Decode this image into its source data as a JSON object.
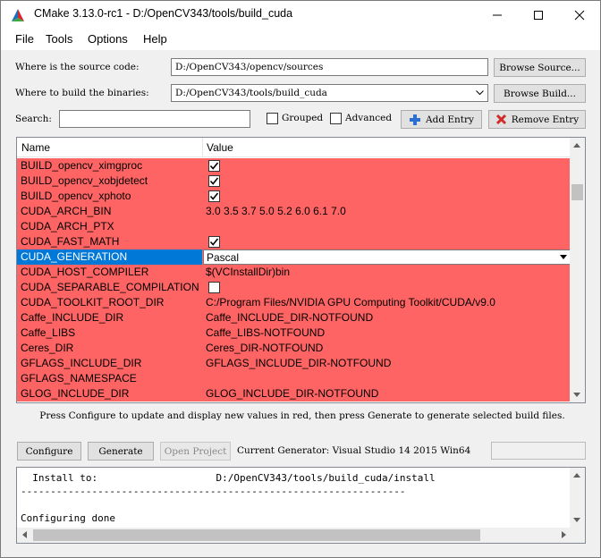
{
  "window": {
    "title": "CMake 3.13.0-rc1 - D:/OpenCV343/tools/build_cuda",
    "minimize_icon": "minimize-icon",
    "maximize_icon": "maximize-icon",
    "close_icon": "close-icon"
  },
  "menu": [
    {
      "label": "File"
    },
    {
      "label": "Tools"
    },
    {
      "label": "Options"
    },
    {
      "label": "Help"
    }
  ],
  "source": {
    "label": "Where is the source code:",
    "value": "D:/OpenCV343/opencv/sources",
    "button": "Browse Source..."
  },
  "binaries": {
    "label": "Where to build the binaries:",
    "value": "D:/OpenCV343/tools/build_cuda",
    "button": "Browse Build..."
  },
  "search": {
    "label": "Search:",
    "value": "",
    "grouped_label": "Grouped",
    "advanced_label": "Advanced",
    "add_entry": "Add Entry",
    "remove_entry": "Remove Entry"
  },
  "table": {
    "headers": {
      "name": "Name",
      "value": "Value"
    },
    "rows": [
      {
        "name": "BUILD_opencv_ximgproc",
        "type": "bool",
        "checked": true
      },
      {
        "name": "BUILD_opencv_xobjdetect",
        "type": "bool",
        "checked": true
      },
      {
        "name": "BUILD_opencv_xphoto",
        "type": "bool",
        "checked": true
      },
      {
        "name": "CUDA_ARCH_BIN",
        "type": "text",
        "value": "3.0 3.5 3.7 5.0 5.2 6.0 6.1 7.0"
      },
      {
        "name": "CUDA_ARCH_PTX",
        "type": "text",
        "value": ""
      },
      {
        "name": "CUDA_FAST_MATH",
        "type": "bool",
        "checked": true
      },
      {
        "name": "CUDA_GENERATION",
        "type": "combo",
        "value": "Pascal",
        "selected": true
      },
      {
        "name": "CUDA_HOST_COMPILER",
        "type": "text",
        "value": "$(VCInstallDir)bin"
      },
      {
        "name": "CUDA_SEPARABLE_COMPILATION",
        "type": "bool",
        "checked": false
      },
      {
        "name": "CUDA_TOOLKIT_ROOT_DIR",
        "type": "text",
        "value": "C:/Program Files/NVIDIA GPU Computing Toolkit/CUDA/v9.0"
      },
      {
        "name": "Caffe_INCLUDE_DIR",
        "type": "text",
        "value": "Caffe_INCLUDE_DIR-NOTFOUND"
      },
      {
        "name": "Caffe_LIBS",
        "type": "text",
        "value": "Caffe_LIBS-NOTFOUND"
      },
      {
        "name": "Ceres_DIR",
        "type": "text",
        "value": "Ceres_DIR-NOTFOUND"
      },
      {
        "name": "GFLAGS_INCLUDE_DIR",
        "type": "text",
        "value": "GFLAGS_INCLUDE_DIR-NOTFOUND"
      },
      {
        "name": "GFLAGS_NAMESPACE",
        "type": "text",
        "value": ""
      },
      {
        "name": "GLOG_INCLUDE_DIR",
        "type": "text",
        "value": "GLOG_INCLUDE_DIR-NOTFOUND"
      }
    ],
    "row_color": "#ff6464",
    "selected_color": "#0078d7"
  },
  "info_text": "Press Configure to update and display new values in red, then press Generate to generate selected build files.",
  "actions": {
    "configure": "Configure",
    "generate": "Generate",
    "open_project": "Open Project",
    "generator_label": "Current Generator: Visual Studio 14 2015 Win64"
  },
  "output": {
    "lines": [
      "  Install to:                    D:/OpenCV343/tools/build_cuda/install",
      "-----------------------------------------------------------------",
      "",
      "Configuring done"
    ]
  }
}
